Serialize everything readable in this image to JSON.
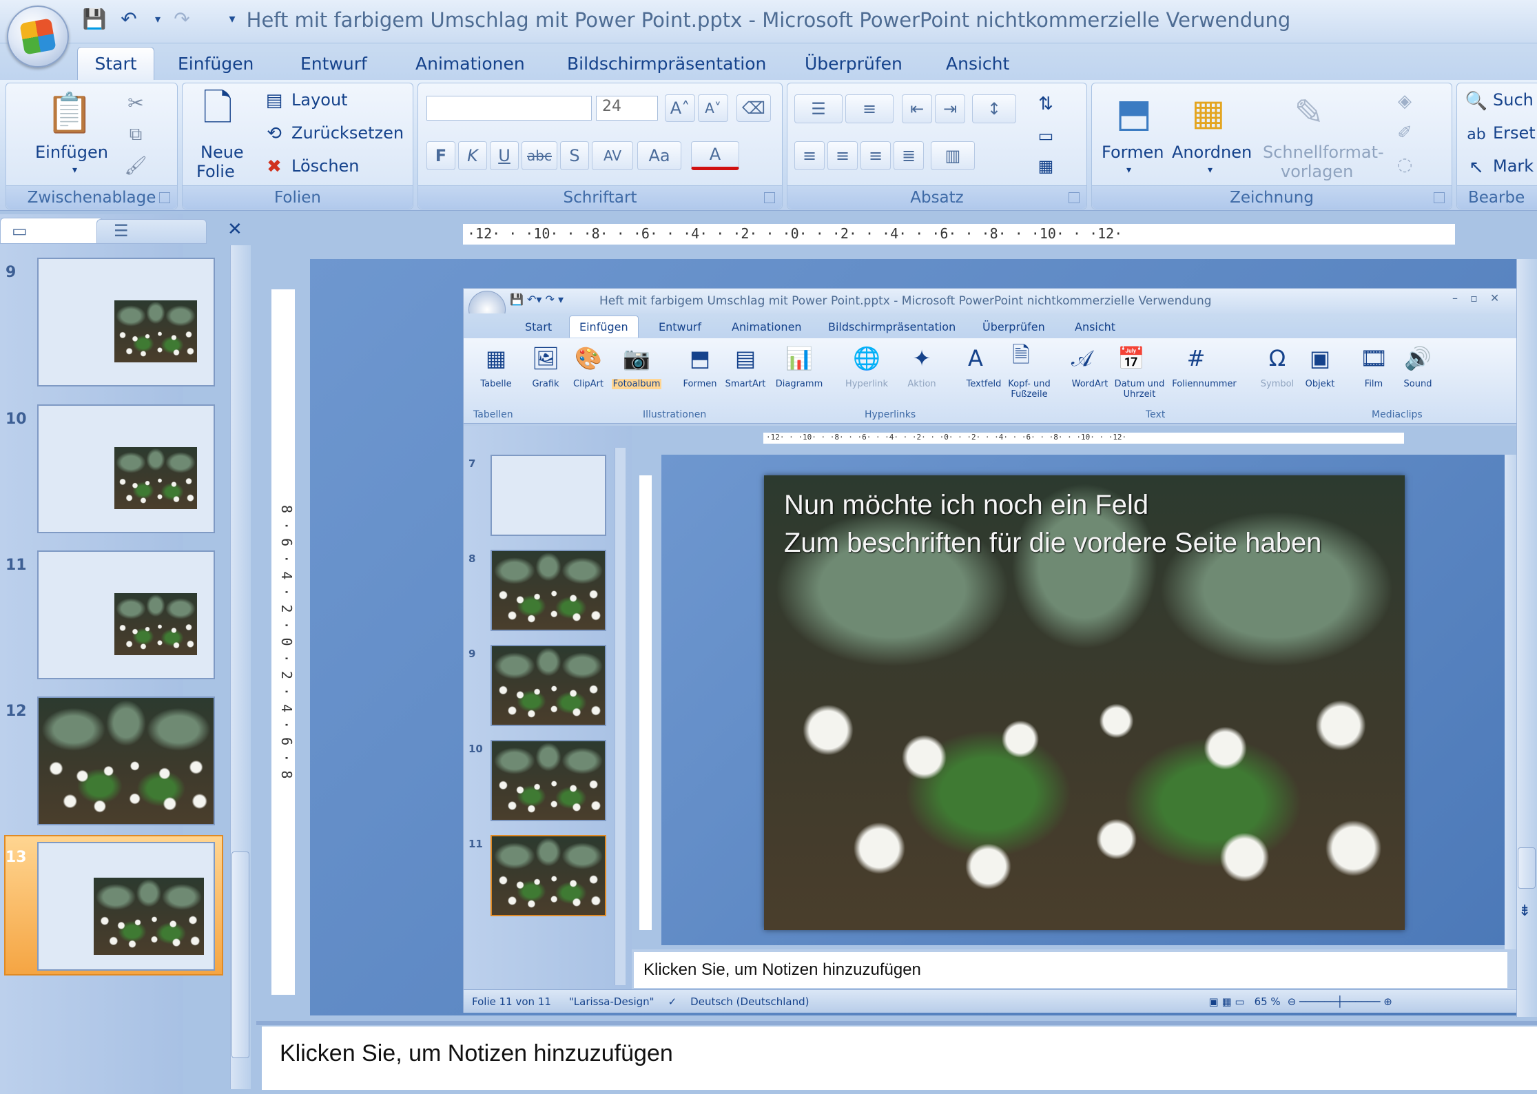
{
  "window": {
    "title": "Heft mit farbigem Umschlag mit Power Point.pptx - Microsoft PowerPoint nichtkommerzielle Verwendung"
  },
  "tabs": [
    "Start",
    "Einfügen",
    "Entwurf",
    "Animationen",
    "Bildschirmpräsentation",
    "Überprüfen",
    "Ansicht"
  ],
  "ribbon": {
    "clipboard": {
      "paste": "Einfügen",
      "label": "Zwischenablage"
    },
    "slides": {
      "new_slide_1": "Neue",
      "new_slide_2": "Folie",
      "layout": "Layout",
      "reset": "Zurücksetzen",
      "delete": "Löschen",
      "label": "Folien"
    },
    "font": {
      "size": "24",
      "label": "Schriftart",
      "bold": "F",
      "italic": "K",
      "underline": "U",
      "strike": "abc",
      "shadow": "S",
      "spacing": "AV",
      "case": "Aa",
      "color": "A"
    },
    "paragraph": {
      "label": "Absatz"
    },
    "drawing": {
      "shapes": "Formen",
      "arrange": "Anordnen",
      "quickstyles_1": "Schnellformat-",
      "quickstyles_2": "vorlagen",
      "label": "Zeichnung"
    },
    "editing": {
      "find": "Such",
      "replace": "Erset",
      "select": "Mark",
      "label": "Bearbe"
    }
  },
  "thumbs": [
    "9",
    "10",
    "11",
    "12",
    "13"
  ],
  "ruler": {
    "h": "·12·  ·  ·10·  ·  ·8·  ·  ·6·  ·  ·4·  ·  ·2·  ·  ·0·  ·  ·2·  ·  ·4·  ·  ·6·  ·  ·8·  ·  ·10·  ·  ·12·",
    "v": "8 · 6 · 4 · 2 · 0 · 2 · 4 · 6 · 8"
  },
  "inner": {
    "title": "Heft mit farbigem Umschlag mit Power Point.pptx - Microsoft PowerPoint nichtkommerzielle Verwendung",
    "tabs": [
      "Start",
      "Einfügen",
      "Entwurf",
      "Animationen",
      "Bildschirmpräsentation",
      "Überprüfen",
      "Ansicht"
    ],
    "buttons": [
      "Tabelle",
      "Grafik",
      "ClipArt",
      "Fotoalbum",
      "Formen",
      "SmartArt",
      "Diagramm",
      "Hyperlink",
      "Aktion",
      "Textfeld",
      "Kopf- und Fußzeile",
      "WordArt",
      "Datum und Uhrzeit",
      "Foliennummer",
      "Symbol",
      "Objekt",
      "Film",
      "Sound"
    ],
    "groups": [
      "Tabellen",
      "Illustrationen",
      "Hyperlinks",
      "Text",
      "Mediaclips"
    ],
    "thumbs": [
      "7",
      "8",
      "9",
      "10",
      "11"
    ],
    "slide_line1": "Nun möchte ich noch ein Feld",
    "slide_line2": "Zum beschriften für die vordere Seite haben",
    "notes": "Klicken Sie, um  Notizen hinzuzufügen",
    "status_slide": "Folie 11 von 11",
    "status_theme": "\"Larissa-Design\"",
    "status_lang": "Deutsch (Deutschland)",
    "zoom": "65 %"
  },
  "notes": "Klicken Sie, um  Notizen hinzuzufügen"
}
